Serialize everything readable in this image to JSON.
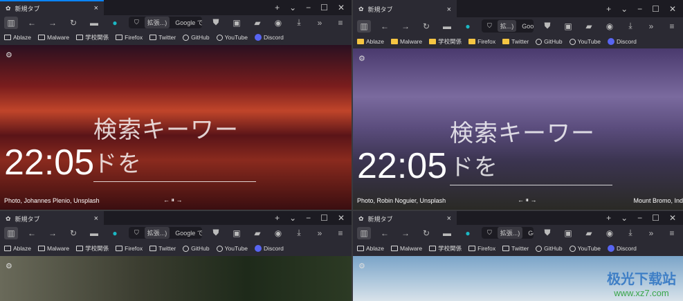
{
  "tab_title": "新規タブ",
  "toolbar": {
    "extension_label": "拡張...)",
    "extension_label_short": "拡...)",
    "url_placeholder_tl": "Google で検索、ま",
    "url_placeholder": "Google で検索、または U",
    "url_placeholder_bottom": "Google で検索、または l"
  },
  "bookmarks": [
    "Ablaze",
    "Malware",
    "学校関係",
    "Firefox",
    "Twitter",
    "GitHub",
    "YouTube",
    "Discord"
  ],
  "new_tab": {
    "search_text": "検索キーワードを",
    "clock": "22:05"
  },
  "windows": [
    {
      "credit": "Photo, Johannes Plenio, Unsplash",
      "location": ""
    },
    {
      "credit": "Photo, Robin Noguier, Unsplash",
      "location": "Mount Bromo, Ind"
    },
    {
      "credit": "",
      "location": ""
    },
    {
      "credit": "",
      "location": ""
    }
  ],
  "colors": {
    "accent": "#0a84ff",
    "chrome": "#2b2a33",
    "folder_yellow": "#f5c542",
    "discord": "#5865f2"
  },
  "watermark": {
    "cn": "极光下载站",
    "en": "www.xz7.com"
  }
}
